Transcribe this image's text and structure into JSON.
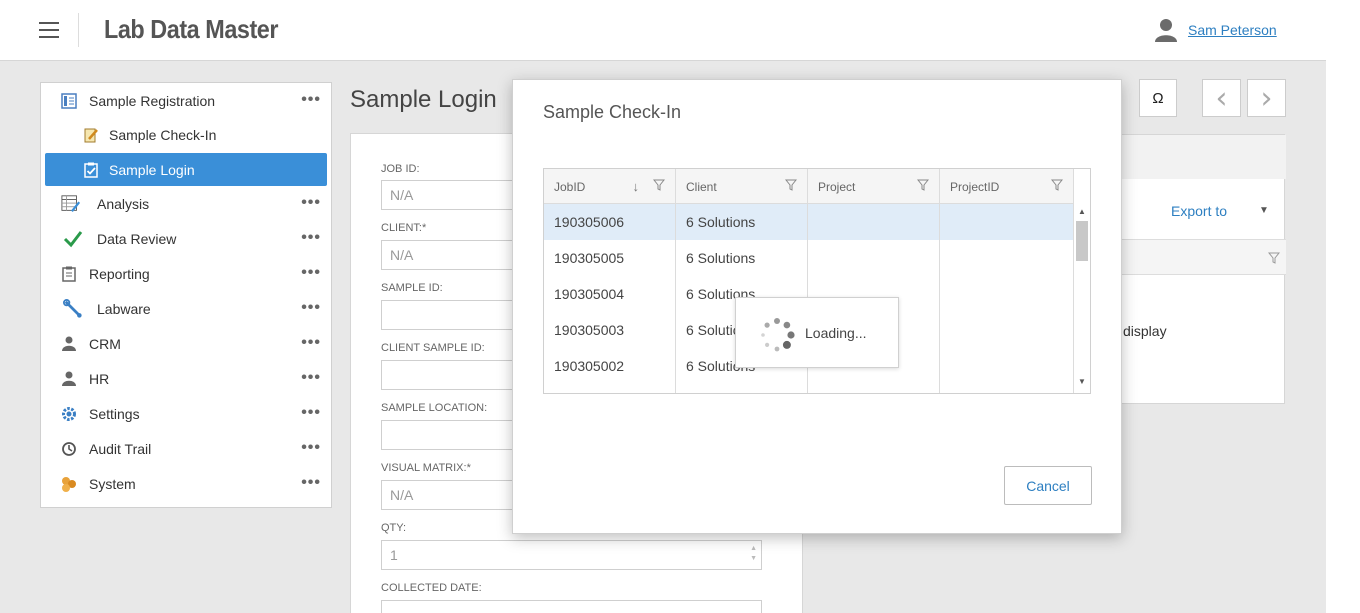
{
  "header": {
    "app_title": "Lab Data Master",
    "user_name": "Sam Peterson"
  },
  "sidebar": {
    "items": [
      {
        "label": "Sample Registration",
        "icon": "registration-icon",
        "has_menu": true
      },
      {
        "label": "Sample Check-In",
        "icon": "checkin-icon",
        "has_menu": false
      },
      {
        "label": "Sample Login",
        "icon": "login-clipboard-icon",
        "has_menu": false,
        "active": true
      },
      {
        "label": "Analysis",
        "icon": "analysis-icon",
        "has_menu": true
      },
      {
        "label": "Data Review",
        "icon": "checkmark-icon",
        "has_menu": true
      },
      {
        "label": "Reporting",
        "icon": "report-icon",
        "has_menu": true
      },
      {
        "label": "Labware",
        "icon": "wrench-icon",
        "has_menu": true
      },
      {
        "label": "CRM",
        "icon": "person-icon",
        "has_menu": true
      },
      {
        "label": "HR",
        "icon": "person-icon",
        "has_menu": true
      },
      {
        "label": "Settings",
        "icon": "gear-icon",
        "has_menu": true
      },
      {
        "label": "Audit Trail",
        "icon": "history-icon",
        "has_menu": true
      },
      {
        "label": "System",
        "icon": "system-icon",
        "has_menu": true
      }
    ],
    "menu_glyph": "•••"
  },
  "main": {
    "page_title": "Sample Login",
    "form": {
      "job_id_label": "JOB ID:",
      "job_id_value": "N/A",
      "client_label": "CLIENT:*",
      "client_value": "N/A",
      "sample_id_label": "SAMPLE ID:",
      "sample_id_value": "",
      "client_sample_id_label": "CLIENT SAMPLE ID:",
      "client_sample_id_value": "",
      "sample_location_label": "SAMPLE LOCATION:",
      "sample_location_value": "",
      "visual_matrix_label": "VISUAL MATRIX:*",
      "visual_matrix_value": "N/A",
      "qty_label": "QTY:",
      "qty_value": "1",
      "collected_date_label": "COLLECTED DATE:",
      "collected_date_value": ""
    },
    "toolbar": {
      "omega_label": "Ω",
      "prev_label": "‹",
      "next_label": "›"
    },
    "right_panel": {
      "export_label": "Export to",
      "no_data_text": "display"
    }
  },
  "modal": {
    "title": "Sample Check-In",
    "columns": [
      "JobID",
      "Client",
      "Project",
      "ProjectID"
    ],
    "rows": [
      {
        "job_id": "190305006",
        "client": "6 Solutions",
        "project": "",
        "project_id": ""
      },
      {
        "job_id": "190305005",
        "client": "6 Solutions",
        "project": "",
        "project_id": ""
      },
      {
        "job_id": "190305004",
        "client": "6 Solutions",
        "project": "",
        "project_id": ""
      },
      {
        "job_id": "190305003",
        "client": "6 Solutions",
        "project": "",
        "project_id": ""
      },
      {
        "job_id": "190305002",
        "client": "6 Solutions",
        "project": "",
        "project_id": ""
      }
    ],
    "loading_text": "Loading...",
    "cancel_label": "Cancel"
  },
  "colors": {
    "accent": "#3a8fd8",
    "link": "#2d7fc1",
    "selected_row": "#e0ecf8"
  }
}
